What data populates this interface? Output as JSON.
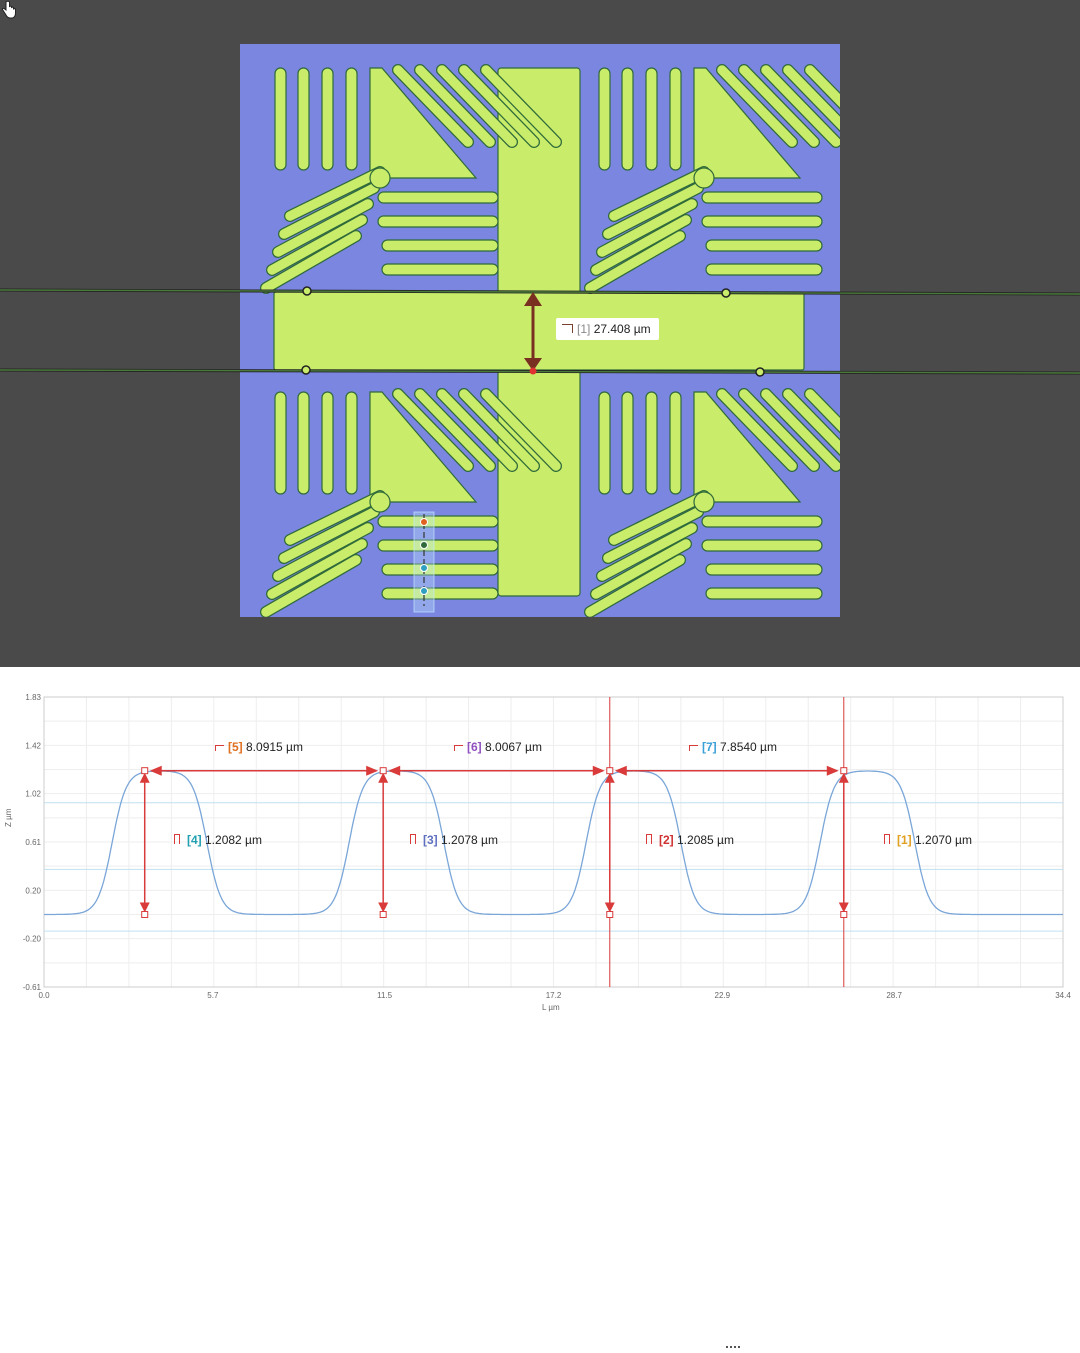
{
  "image_measurement": {
    "index": "[1]",
    "value": "27.408 µm",
    "arrow_color": "#7a3020"
  },
  "colors": {
    "viewer_bg": "#4a4a4a",
    "substrate": "#7b86e0",
    "pattern": "#c9ec6a",
    "profile_line": "#7aa6d8",
    "measure": "#d93a3a",
    "guide": "#5ac8e0"
  },
  "profile": {
    "y_axis": {
      "title": "Z µm",
      "ticks": [
        "1.83",
        "1.42",
        "1.02",
        "0.61",
        "0.20",
        "-0.20",
        "-0.61"
      ]
    },
    "x_axis": {
      "title": "L µm",
      "ticks": [
        "0.0",
        "5.7",
        "11.5",
        "17.2",
        "22.9",
        "28.7",
        "34.4"
      ]
    },
    "horizontal_measures": [
      {
        "index": "[5]",
        "value": "8.0915 µm",
        "color": "#e07020"
      },
      {
        "index": "[6]",
        "value": "8.0067 µm",
        "color": "#9050c0"
      },
      {
        "index": "[7]",
        "value": "7.8540 µm",
        "color": "#3aa0d8"
      }
    ],
    "vertical_measures": [
      {
        "index": "[4]",
        "value": "1.2082 µm",
        "color": "#20a0b0"
      },
      {
        "index": "[3]",
        "value": "1.2078 µm",
        "color": "#6070c0"
      },
      {
        "index": "[2]",
        "value": "1.2085 µm",
        "color": "#d03030"
      },
      {
        "index": "[1]",
        "value": "1.2070 µm",
        "color": "#e0a020"
      }
    ]
  }
}
